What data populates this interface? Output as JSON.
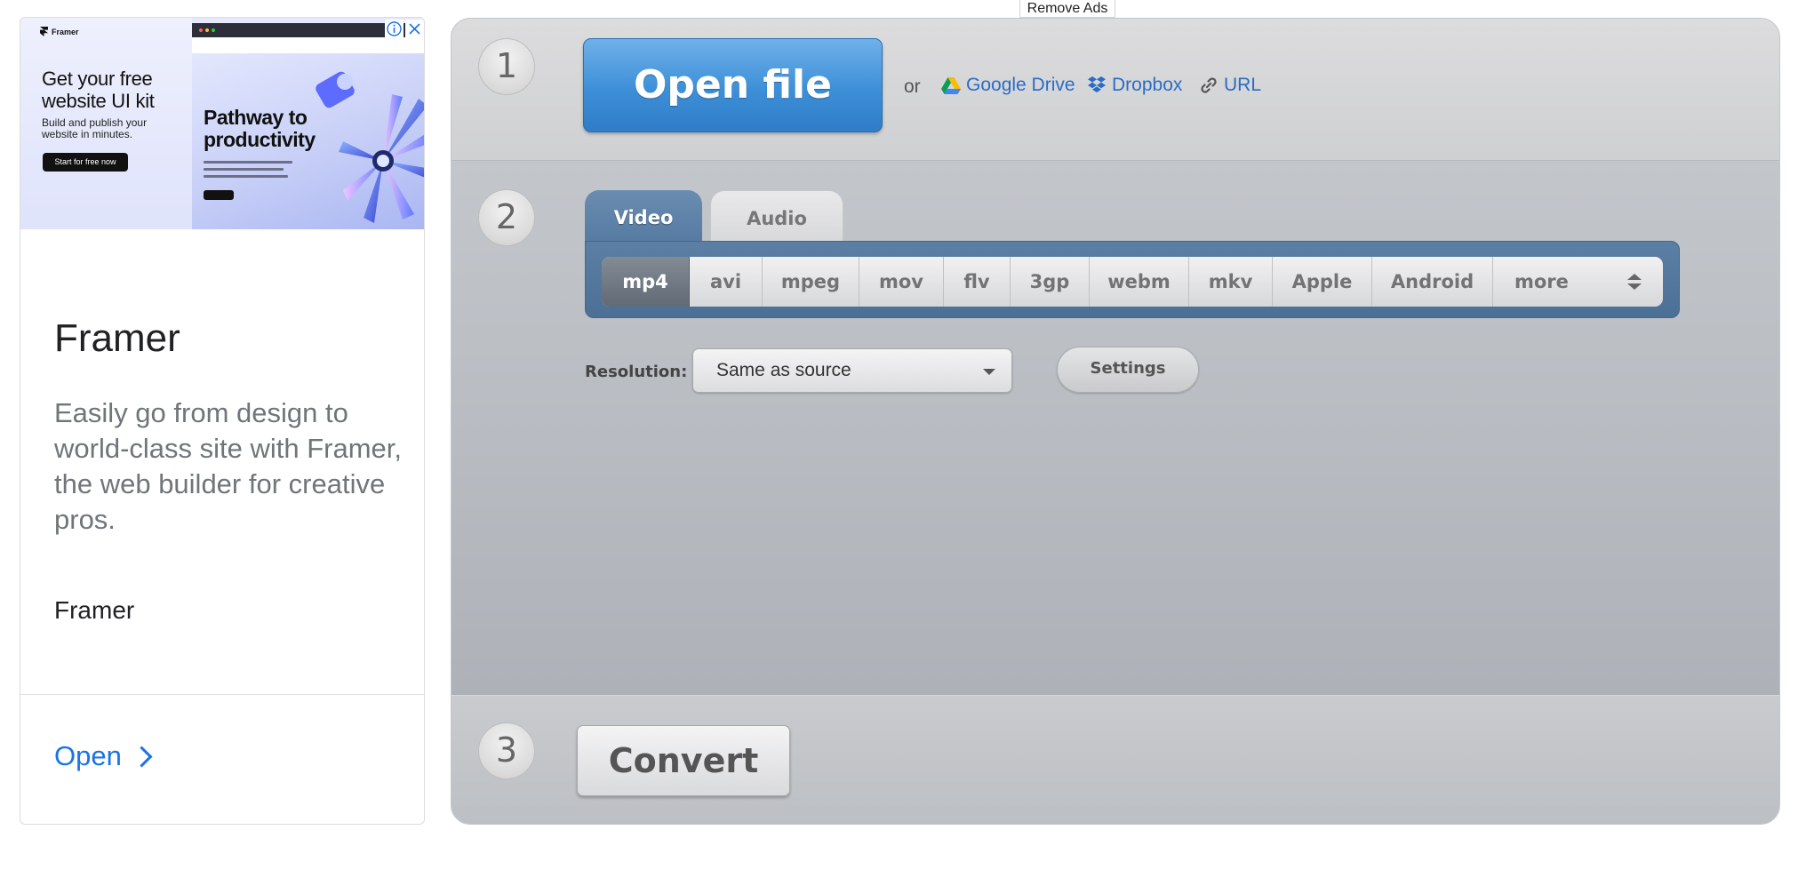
{
  "top": {
    "remove_ads": "Remove Ads"
  },
  "ad": {
    "banner_logo": "Framer",
    "banner_headline": "Get your free website UI kit",
    "banner_sub": "Build and publish your website in minutes.",
    "banner_cta": "Start for free now",
    "banner_shot_headline": "Pathway to productivity",
    "info_icon": "info-icon",
    "close_icon": "close-icon",
    "title": "Framer",
    "description": "Easily go from design to world-class site with Framer, the web builder for creative pros.",
    "brand": "Framer",
    "open_label": "Open"
  },
  "converter": {
    "steps": [
      "1",
      "2",
      "3"
    ],
    "open_file": "Open file",
    "or": "or",
    "sources": [
      {
        "label": "Google Drive",
        "icon": "google-drive-icon"
      },
      {
        "label": "Dropbox",
        "icon": "dropbox-icon"
      },
      {
        "label": "URL",
        "icon": "link-icon"
      }
    ],
    "tabs": [
      {
        "label": "Video",
        "active": true
      },
      {
        "label": "Audio",
        "active": false
      }
    ],
    "formats": [
      "mp4",
      "avi",
      "mpeg",
      "mov",
      "flv",
      "3gp",
      "webm",
      "mkv",
      "Apple",
      "Android",
      "more"
    ],
    "active_format": "mp4",
    "resolution_label": "Resolution:",
    "resolution_value": "Same as source",
    "settings": "Settings",
    "convert": "Convert"
  },
  "colors": {
    "accent_blue": "#3d8fd8",
    "link_blue": "#2a6cc7",
    "tab_blue": "#557aa1",
    "ad_link": "#1a73e8"
  }
}
